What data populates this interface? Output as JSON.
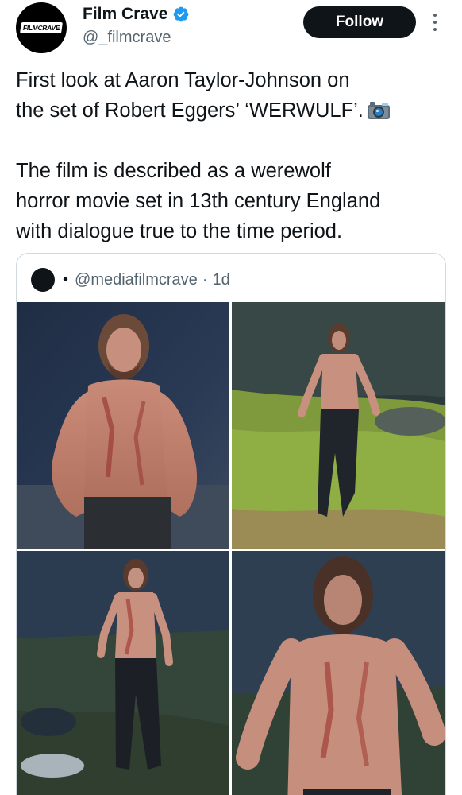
{
  "account": {
    "avatar_logo_text": "FILMCRAVE",
    "display_name": "Film Crave",
    "handle": "@_filmcrave",
    "verified": true,
    "follow_label": "Follow"
  },
  "tweet": {
    "paragraph_1": "First look at Aaron Taylor-Johnson on\nthe set of Robert Eggers’ ‘WERWULF’.",
    "paragraph_2": "The film is described as a werewolf\nhorror movie set in 13th century England\nwith dialogue true to the time period.",
    "emoji_icon": "camera-with-flash-icon"
  },
  "quote": {
    "bullet": "•",
    "handle": "@mediafilmcrave",
    "separator": "·",
    "time": "1d",
    "photos": [
      {
        "name": "photo-1",
        "subject": "shirtless bearded man, close-up"
      },
      {
        "name": "photo-2",
        "subject": "man walking on grassy hill"
      },
      {
        "name": "photo-3",
        "subject": "man standing by stone wall"
      },
      {
        "name": "photo-4",
        "subject": "man close-up, blurred"
      }
    ]
  },
  "colors": {
    "text_primary": "#0f1419",
    "text_secondary": "#536471",
    "verified_blue": "#1d9bf0",
    "border": "#cfd9de",
    "follow_bg": "#0f1419"
  }
}
